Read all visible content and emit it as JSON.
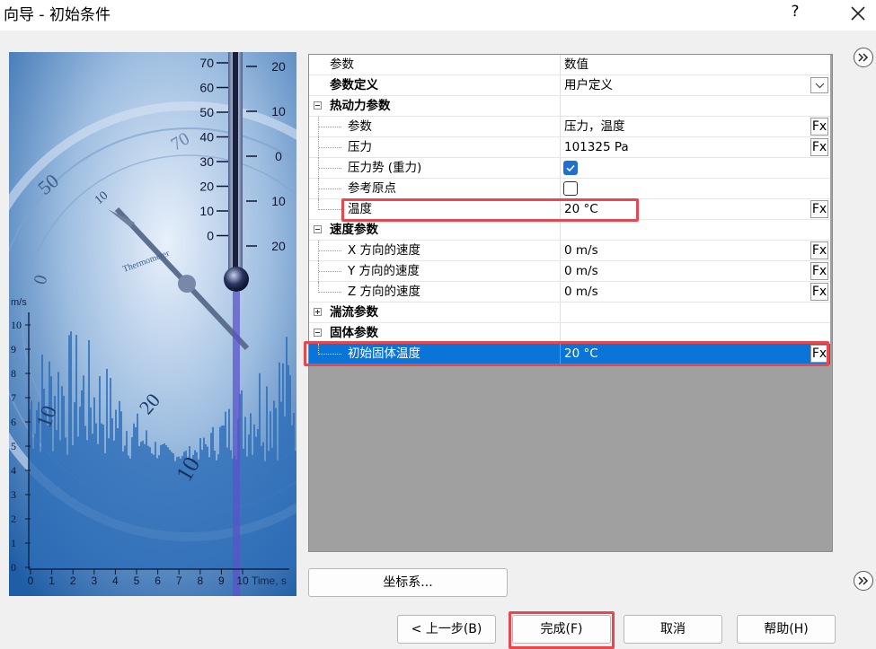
{
  "window": {
    "title": "向导 - 初始条件",
    "help_label": "?",
    "icons": {
      "close": "close-icon"
    }
  },
  "grid": {
    "header": {
      "param": "参数",
      "value": "数值"
    },
    "rows": [
      {
        "name": "参数定义",
        "value": "用户定义",
        "bold": true
      },
      {
        "name": "热动力参数",
        "bold": true,
        "group": true
      },
      {
        "name": "参数",
        "value": "压力，温度"
      },
      {
        "name": "压力",
        "value": "101325 Pa"
      },
      {
        "name": "压力势 (重力)",
        "checked": true
      },
      {
        "name": "参考原点",
        "checked": false
      },
      {
        "name": "温度",
        "value": "20 °C"
      },
      {
        "name": "速度参数",
        "bold": true,
        "group": true
      },
      {
        "name": "X 方向的速度",
        "value": "0 m/s"
      },
      {
        "name": "Y 方向的速度",
        "value": "0 m/s"
      },
      {
        "name": "Z 方向的速度",
        "value": "0 m/s"
      },
      {
        "name": "湍流参数",
        "bold": true,
        "group": true
      },
      {
        "name": "固体参数",
        "bold": true,
        "group": true
      },
      {
        "name": "初始固体温度",
        "value": "20 °C",
        "selected": true
      }
    ],
    "fx_label": "Fx"
  },
  "image": {
    "thermo_scale": [
      "70",
      "60",
      "50",
      "40",
      "30",
      "20",
      "10",
      "0"
    ],
    "thermo_right": [
      "20",
      "10",
      "0",
      "10",
      "20"
    ],
    "dial_labels": [
      "50",
      "70",
      "10",
      "0",
      "10",
      "20",
      "10"
    ],
    "brand": "Thermometer",
    "y_label": "m/s",
    "y_ticks": [
      "10",
      "9",
      "8",
      "7",
      "6",
      "5",
      "4",
      "3",
      "2",
      "1",
      "0"
    ],
    "x_ticks": [
      "0",
      "1",
      "2",
      "3",
      "4",
      "5",
      "6",
      "7",
      "8",
      "9",
      "10"
    ],
    "x_label": "Time, s"
  },
  "buttons": {
    "coordinate_system": "坐标系...",
    "back": "< 上一步(B)",
    "finish": "完成(F)",
    "cancel": "取消",
    "help": "帮助(H)"
  },
  "colors": {
    "selection": "#0a74d8",
    "highlight": "#e8474d",
    "checkbox": "#1f6fd6"
  }
}
